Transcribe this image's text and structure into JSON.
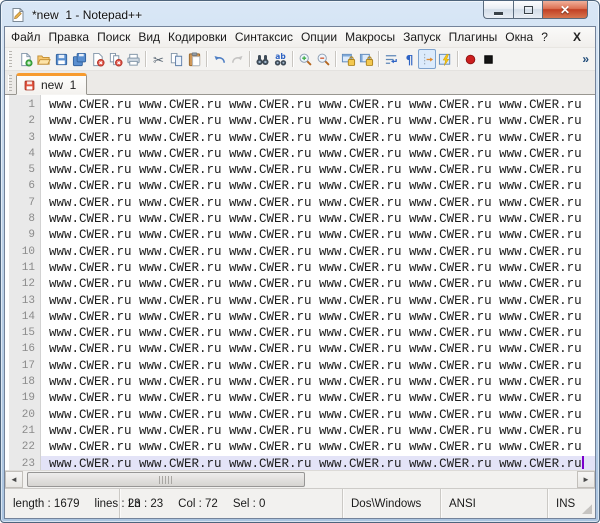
{
  "window": {
    "title": "*new  1 - Notepad++"
  },
  "titlebar": {
    "buttons": [
      "minimize",
      "maximize",
      "close"
    ]
  },
  "menu": {
    "items": [
      "Файл",
      "Правка",
      "Поиск",
      "Вид",
      "Кодировки",
      "Синтаксис",
      "Опции",
      "Макросы",
      "Запуск",
      "Плагины",
      "Окна",
      "?"
    ],
    "close_document_label": "X"
  },
  "toolbar": {
    "items": [
      "new-file",
      "open-file",
      "save",
      "save-all",
      "close-file",
      "close-all",
      "print",
      "separator",
      "cut",
      "copy",
      "paste",
      "separator",
      "undo",
      "redo",
      "separator",
      "find",
      "replace",
      "separator",
      "zoom-in",
      "zoom-out",
      "separator",
      "sync-vertical-scroll",
      "sync-horizontal-scroll",
      "separator",
      "word-wrap",
      "show-all-chars",
      "indent-guide",
      "doc-switcher",
      "separator",
      "macro-record",
      "macro-stop"
    ],
    "pressed": "indent-guide",
    "disabled": [
      "redo"
    ],
    "overflow_label": "»"
  },
  "tabs": [
    {
      "label": "new  1",
      "active": true,
      "modified": true
    }
  ],
  "editor": {
    "line_count": 23,
    "current_line": 23,
    "line_text": "www.CWER.ru www.CWER.ru www.CWER.ru www.CWER.ru www.CWER.ru www.CWER.ru",
    "caret_color": "#7a00cc",
    "current_line_color": "#e3e3f7"
  },
  "statusbar": {
    "length_label": "length : 1679",
    "lines_label": "lines : 23",
    "ln_label": "Ln : 23",
    "col_label": "Col : 72",
    "sel_label": "Sel : 0",
    "eol_format": "Dos\\Windows",
    "encoding": "ANSI",
    "typing_mode": "INS"
  },
  "colors": {
    "active_tab_top": "#f79b2e",
    "aero_frame": "#bfd4ea",
    "modified_tab_icon": "#e4543f"
  }
}
